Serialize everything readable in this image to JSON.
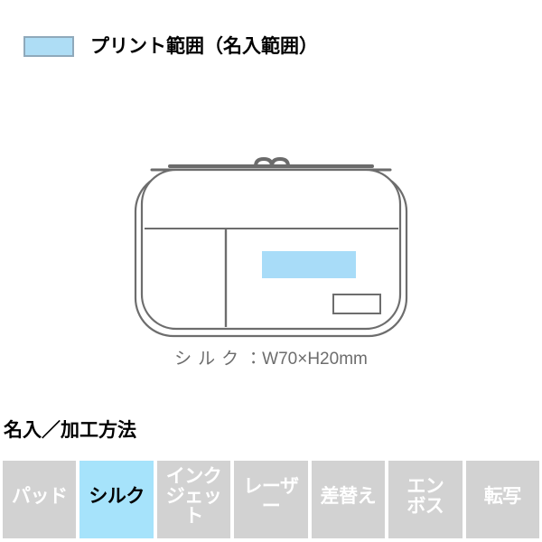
{
  "legend": {
    "swatch_icon": "print-area-swatch",
    "swatch_fill": "#aeddf5",
    "swatch_border": "#8fa9bb",
    "label": "プリント範囲（名入範囲）"
  },
  "illustration": {
    "product_name": "pencil-pouch",
    "outline_color": "#6d6d6d",
    "body_fill": "#ffffff",
    "zipper_color": "#6b6b6b",
    "print_area_fill": "#a8dcf8",
    "parts": [
      "outer-shell-outline",
      "inner-lining-outline",
      "top-zipper",
      "zipper-pull-left",
      "zipper-pull-right",
      "horizontal-seam",
      "vertical-divider-seam",
      "print-area",
      "brand-tag"
    ]
  },
  "dimension": {
    "method_label": "シルク",
    "separator": "：",
    "value": "W70×H20mm"
  },
  "methods": {
    "heading": "名入／加工方法",
    "items": [
      {
        "label": "パッド",
        "active": false
      },
      {
        "label": "シルク",
        "active": true
      },
      {
        "label": "インク\nジェット",
        "active": false
      },
      {
        "label": "レーザー",
        "active": false
      },
      {
        "label": "差替え",
        "active": false
      },
      {
        "label": "エン\nボス",
        "active": false
      },
      {
        "label": "転写",
        "active": false
      }
    ],
    "inactive_bg": "#d2d2d2",
    "inactive_fg": "#ffffff",
    "active_bg": "#a6e3fb",
    "active_fg": "#000000"
  }
}
